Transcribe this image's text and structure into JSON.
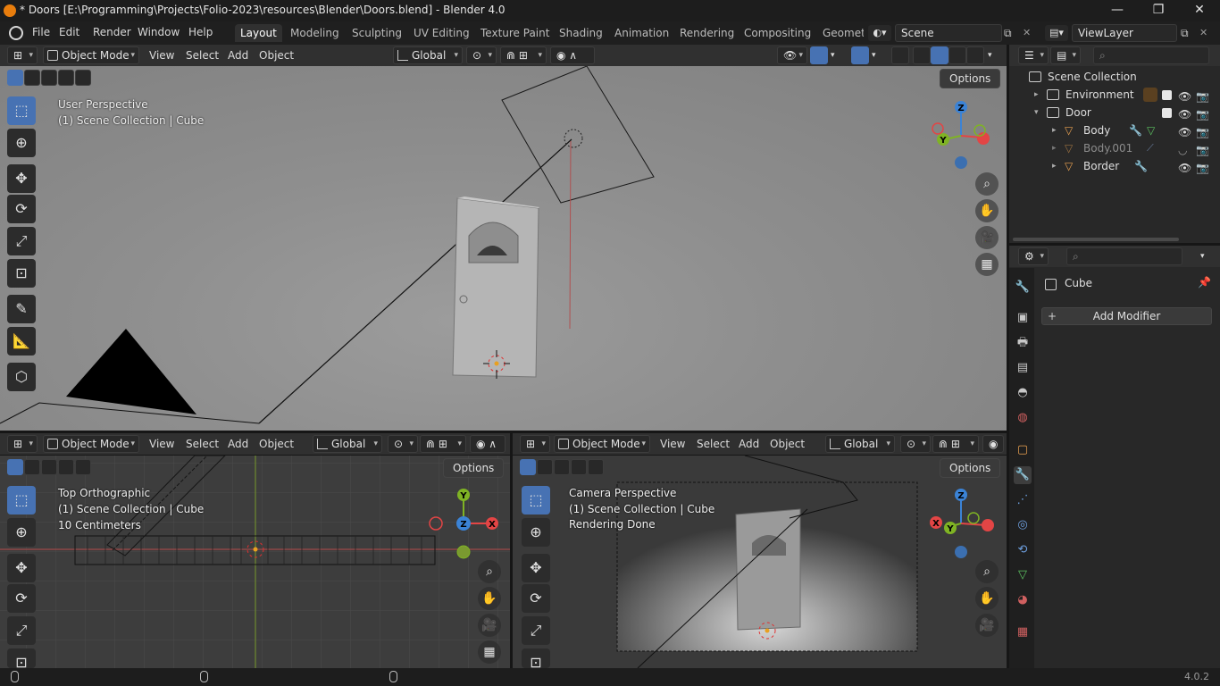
{
  "window": {
    "title": "* Doors [E:\\Programming\\Projects\\Folio-2023\\resources\\Blender\\Doors.blend] - Blender 4.0",
    "minimize": "—",
    "maximize": "❐",
    "close": "✕"
  },
  "menu": {
    "file": "File",
    "edit": "Edit",
    "render": "Render",
    "window": "Window",
    "help": "Help"
  },
  "workspaces": [
    "Layout",
    "Modeling",
    "Sculpting",
    "UV Editing",
    "Texture Paint",
    "Shading",
    "Animation",
    "Rendering",
    "Compositing",
    "Geomet"
  ],
  "scene": {
    "name": "Scene",
    "view_layer": "ViewLayer"
  },
  "viewport_header": {
    "mode": "Object Mode",
    "view": "View",
    "select": "Select",
    "add": "Add",
    "object": "Object",
    "orientation": "Global",
    "options": "Options"
  },
  "viewport_main": {
    "line1": "User Perspective",
    "line2": "(1) Scene Collection | Cube"
  },
  "viewport_top": {
    "line1": "Top Orthographic",
    "line2": "(1) Scene Collection | Cube",
    "line3": "10 Centimeters"
  },
  "viewport_cam": {
    "line1": "Camera Perspective",
    "line2": "(1) Scene Collection | Cube",
    "line3": "Rendering Done"
  },
  "gizmo": {
    "x": "X",
    "y": "Y",
    "z": "Z"
  },
  "outliner": {
    "root": "Scene Collection",
    "items": [
      {
        "name": "Environment"
      },
      {
        "name": "Door"
      },
      {
        "name": "Body"
      },
      {
        "name": "Body.001"
      },
      {
        "name": "Border"
      }
    ]
  },
  "properties": {
    "object_name": "Cube",
    "add_modifier": "Add Modifier"
  },
  "status": {
    "version": "4.0.2"
  },
  "colors": {
    "accent": "#4772b3",
    "x_axis": "#e34545",
    "y_axis": "#7fb324",
    "z_axis": "#3b83d6"
  }
}
